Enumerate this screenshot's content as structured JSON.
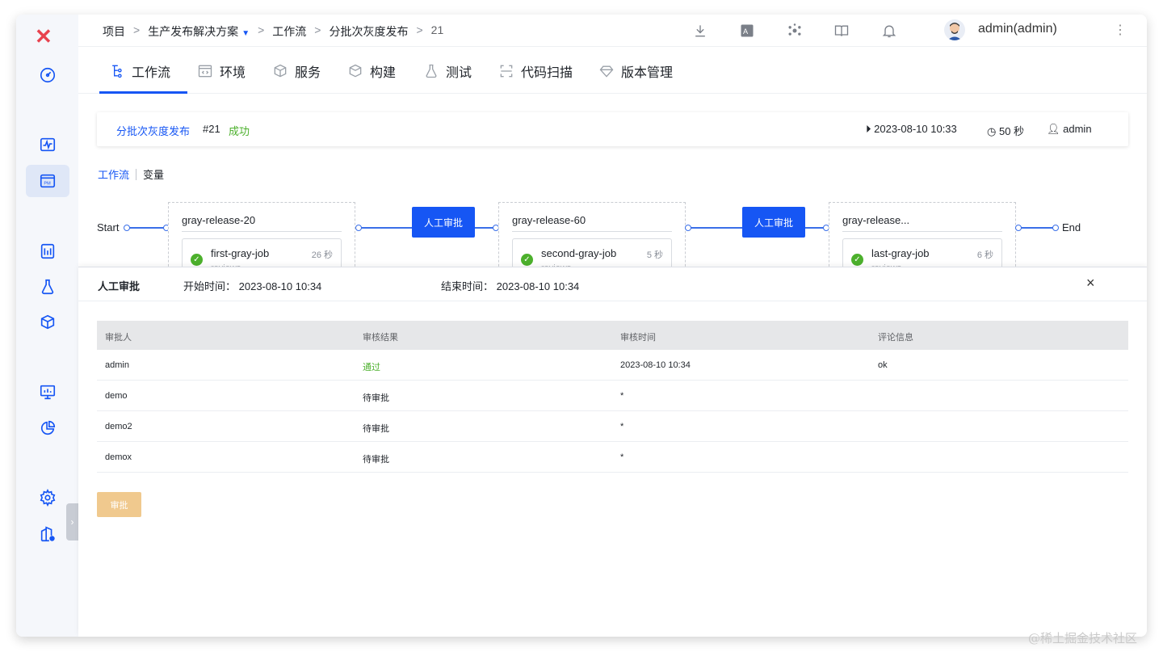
{
  "breadcrumb": {
    "items": [
      "项目",
      "生产发布解决方案",
      "工作流",
      "分批次灰度发布",
      "21"
    ],
    "separator": ">"
  },
  "user": {
    "name": "admin(admin)"
  },
  "tabs": [
    {
      "label": "工作流",
      "icon": "workflow-icon"
    },
    {
      "label": "环境",
      "icon": "code-env-icon"
    },
    {
      "label": "服务",
      "icon": "cube-service-icon"
    },
    {
      "label": "构建",
      "icon": "box-build-icon"
    },
    {
      "label": "测试",
      "icon": "flask-test-icon"
    },
    {
      "label": "代码扫描",
      "icon": "scan-icon"
    },
    {
      "label": "版本管理",
      "icon": "diamond-version-icon"
    }
  ],
  "run": {
    "name": "分批次灰度发布",
    "number": "#21",
    "status": "成功",
    "start_time": "2023-08-10 10:33",
    "duration": "50 秒",
    "user": "admin"
  },
  "subtabs": [
    "工作流",
    "变量"
  ],
  "flow": {
    "start": "Start",
    "end": "End",
    "stages": [
      {
        "title": "gray-release-20",
        "job": "first-gray-job",
        "duration": "26 秒",
        "sub": "reviews"
      },
      {
        "title": "gray-release-60",
        "job": "second-gray-job",
        "duration": "5 秒",
        "sub": "reviews"
      },
      {
        "title": "gray-release...",
        "job": "last-gray-job",
        "duration": "6 秒",
        "sub": "reviews"
      }
    ],
    "gates": [
      "人工审批",
      "人工审批"
    ]
  },
  "panel": {
    "title": "人工审批",
    "start_label": "开始时间：",
    "start_value": "2023-08-10 10:34",
    "end_label": "结束时间：",
    "end_value": "2023-08-10 10:34",
    "close": "×"
  },
  "table": {
    "headers": [
      "审批人",
      "审核结果",
      "审核时间",
      "评论信息"
    ],
    "rows": [
      [
        "admin",
        "通过",
        "2023-08-10 10:34",
        "ok"
      ],
      [
        "demo",
        "待审批",
        "*",
        ""
      ],
      [
        "demo2",
        "待审批",
        "*",
        ""
      ],
      [
        "demox",
        "待审批",
        "*",
        ""
      ]
    ]
  },
  "approve_button": "审批",
  "watermark": "@稀土掘金技术社区",
  "colors": {
    "accent": "#1656f4",
    "success": "#4cb02c",
    "logo": "#e8424e",
    "approve_disabled": "#f0c98e"
  }
}
